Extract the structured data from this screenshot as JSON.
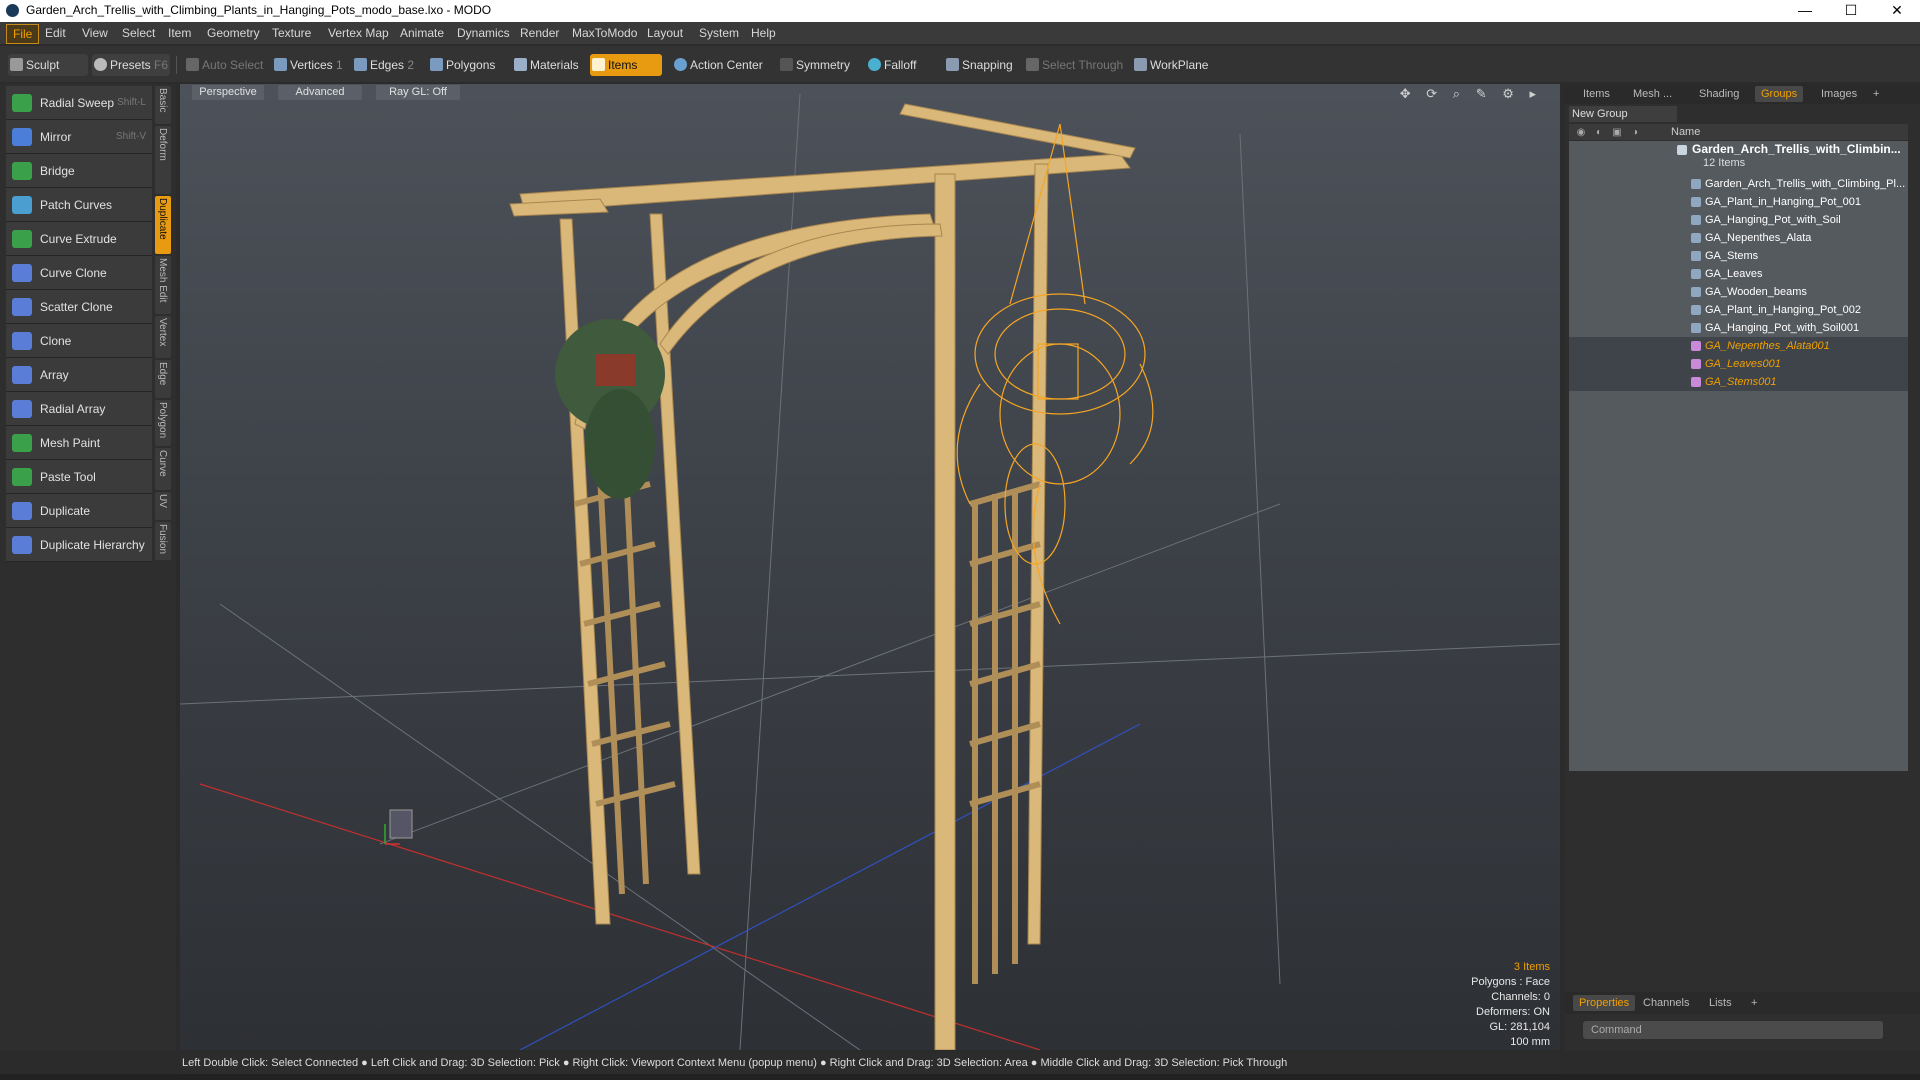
{
  "window": {
    "title": "Garden_Arch_Trellis_with_Climbing_Plants_in_Hanging_Pots_modo_base.lxo - MODO",
    "minimize": "—",
    "maximize": "☐",
    "close": "✕"
  },
  "menu": [
    "File",
    "Edit",
    "View",
    "Select",
    "Item",
    "Geometry",
    "Texture",
    "Vertex Map",
    "Animate",
    "Dynamics",
    "Render",
    "MaxToModo",
    "Layout",
    "System",
    "Help"
  ],
  "toolbar": {
    "sculpt": "Sculpt",
    "presets": "Presets",
    "presets_key": "F6",
    "auto_select": "Auto Select",
    "vertices": "Vertices",
    "vertices_n": "1",
    "edges": "Edges",
    "edges_n": "2",
    "polygons": "Polygons",
    "materials": "Materials",
    "items": "Items",
    "action_center": "Action Center",
    "symmetry": "Symmetry",
    "falloff": "Falloff",
    "snapping": "Snapping",
    "select_through": "Select Through",
    "workplane": "WorkPlane"
  },
  "tools": [
    {
      "label": "Radial Sweep",
      "key": "Shift-L",
      "color": "#3aa04a"
    },
    {
      "label": "Mirror",
      "key": "Shift-V",
      "color": "#4a7ed8"
    },
    {
      "label": "Bridge",
      "key": "",
      "color": "#3aa04a"
    },
    {
      "label": "Patch Curves",
      "key": "",
      "color": "#4a9ed0"
    },
    {
      "label": "Curve Extrude",
      "key": "",
      "color": "#3aa04a"
    },
    {
      "label": "Curve Clone",
      "key": "",
      "color": "#5a7ed8"
    },
    {
      "label": "Scatter Clone",
      "key": "",
      "color": "#5a7ed8"
    },
    {
      "label": "Clone",
      "key": "",
      "color": "#5a7ed8"
    },
    {
      "label": "Array",
      "key": "",
      "color": "#5a7ed8"
    },
    {
      "label": "Radial Array",
      "key": "",
      "color": "#5a7ed8"
    },
    {
      "label": "Mesh Paint",
      "key": "",
      "color": "#3aa04a"
    },
    {
      "label": "Paste Tool",
      "key": "",
      "color": "#3aa04a"
    },
    {
      "label": "Duplicate",
      "key": "",
      "color": "#5a7ed8"
    },
    {
      "label": "Duplicate Hierarchy",
      "key": "",
      "color": "#5a7ed8"
    }
  ],
  "vtabs": [
    "Basic",
    "Deform",
    "Duplicate",
    "Mesh Edit",
    "Vertex",
    "Edge",
    "Polygon",
    "Curve",
    "UV",
    "Fusion"
  ],
  "viewport": {
    "perspective": "Perspective",
    "advanced": "Advanced",
    "raygl": "Ray GL: Off",
    "icons": "✥ ⟳ ⌕ ✎ ⚙ ▸"
  },
  "stats": {
    "items": "3 Items",
    "polygons": "Polygons : Face",
    "channels": "Channels: 0",
    "deformers": "Deformers: ON",
    "gl": "GL: 281,104",
    "unit": "100 mm"
  },
  "right_tabs": [
    "Items",
    "Mesh ...",
    "Shading",
    "Groups",
    "Images",
    "+"
  ],
  "groups": {
    "new_group": "New Group",
    "name_header": "Name",
    "root": "Garden_Arch_Trellis_with_Climbin...",
    "root_count": "12 Items",
    "rows": [
      {
        "label": "Garden_Arch_Trellis_with_Climbing_Pl...",
        "sel": false
      },
      {
        "label": "GA_Plant_in_Hanging_Pot_001",
        "sel": false
      },
      {
        "label": "GA_Hanging_Pot_with_Soil",
        "sel": false
      },
      {
        "label": "GA_Nepenthes_Alata",
        "sel": false
      },
      {
        "label": "GA_Stems",
        "sel": false
      },
      {
        "label": "GA_Leaves",
        "sel": false
      },
      {
        "label": "GA_Wooden_beams",
        "sel": false
      },
      {
        "label": "GA_Plant_in_Hanging_Pot_002",
        "sel": false
      },
      {
        "label": "GA_Hanging_Pot_with_Soil001",
        "sel": false
      },
      {
        "label": "GA_Nepenthes_Alata001",
        "sel": true
      },
      {
        "label": "GA_Leaves001",
        "sel": true
      },
      {
        "label": "GA_Stems001",
        "sel": true
      }
    ]
  },
  "bottom_tabs": [
    "Properties",
    "Channels",
    "Lists",
    "+"
  ],
  "command": {
    "placeholder": "Command"
  },
  "status": "Left Double Click: Select Connected ● Left Click and Drag: 3D Selection: Pick ● Right Click: Viewport Context Menu (popup menu) ● Right Click and Drag: 3D Selection: Area ● Middle Click and Drag: 3D Selection: Pick Through",
  "colors": {
    "accent": "#f0a000",
    "wood": "#d9b87a",
    "wireframe": "#f5a623"
  }
}
